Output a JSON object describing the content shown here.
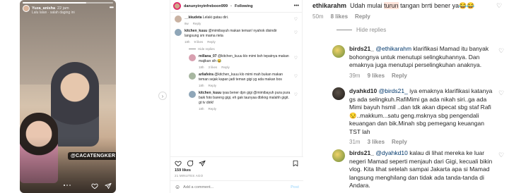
{
  "story": {
    "username": "Yuza_anisha",
    "time": "22 jam",
    "subtitle": "Lalu lalan · salah daging ini",
    "tag": "@CACATENGKER",
    "progress": 0.7
  },
  "post": {
    "username": "danunyinyinfreboon999",
    "separator": "•",
    "follow": "Following",
    "comments": [
      {
        "user": "__kkudeta",
        "text": "Lelaki gatau diri.",
        "time": "8w",
        "reply": "Reply",
        "likes": ""
      },
      {
        "user": "kitchen_kuuu",
        "text": "@mimibayuh makan teman! nyahok disindir langsung sm mama rieta",
        "time": "18h",
        "reply": "Reply",
        "likes": "9 likes"
      }
    ],
    "hide_replies": "Hide replies",
    "replies": [
      {
        "user": "millana_07",
        "text": "@kitchen_kuuu klo mimi bsh tepatnya makan majikan sih 😂",
        "time": "18h",
        "reply": "Reply",
        "likes": "3 likes"
      },
      {
        "user": "arliafeira",
        "text": "@kitchen_kuuu klo mimi mah bukan makan teman sejak kapan jadi teman gigi yg ada makan bos",
        "time": "18h",
        "reply": "Reply",
        "likes": ""
      },
      {
        "user": "kitchen_kuuu",
        "text": "iyaa bener dpn gigi @mimibayuh pura pura baik foto bareng gigi, eh gak taunyaa dbikng malahh gigit. gt tv dirik!",
        "time": "18h",
        "reply": "Reply",
        "likes": ""
      }
    ],
    "likes": "159 likes",
    "date": "21 MINUTES AGO",
    "add_comment_placeholder": "Add a comment...",
    "post_button": "Post"
  },
  "thread": {
    "top": {
      "user": "ethikarahm",
      "text_before": "Udah mulai ",
      "highlight": "turun",
      "text_after": " tangan brrti bener ya😂😂",
      "time": "50m",
      "likes": "8 likes",
      "reply": "Reply"
    },
    "hide_replies": "Hide replies",
    "replies": [
      {
        "user": "birds21_",
        "mention": "@ethikarahm",
        "text": " klarifikasi Mamad itu banyak bohongnya untuk menutupi selingkuhannya. Dan emaknya juga menutupi perselingkuhan anaknya.",
        "time": "39m",
        "likes": "9 likes",
        "reply": "Reply"
      },
      {
        "user": "dyahkd10",
        "mention": "@birds21_",
        "text": " iya emaknya klarifikasi katanya gs ada selingkuh.RafiMimi ga ada nikah siri..ga ada Mimi bayuh hsmil ..dan tdk akan dipecat sbg staf Rafi 😒..makkum...satu geng.msknya sbg pengendali keuangan dan bik.Minah sbg pemegang keuangan TST lah",
        "time": "31m",
        "likes": "3 likes",
        "reply": "Reply"
      },
      {
        "user": "birds21_",
        "mention": "@dyahkd10",
        "text": " kalau di lihat mereka ke luar negeri Mamad seperti menjauh dari Gigi, kecuali bikin vlog. Kita lihat setelah sampai Jakarta apa si Mamad langsung menghilang dan tidak ada tanda-tanda di Andara.",
        "time": "",
        "likes": "",
        "reply": ""
      }
    ]
  },
  "colors": {
    "mention": "#00376b",
    "highlight": "#ffe3d9",
    "meta": "#8e8e8e",
    "text": "#262626"
  }
}
